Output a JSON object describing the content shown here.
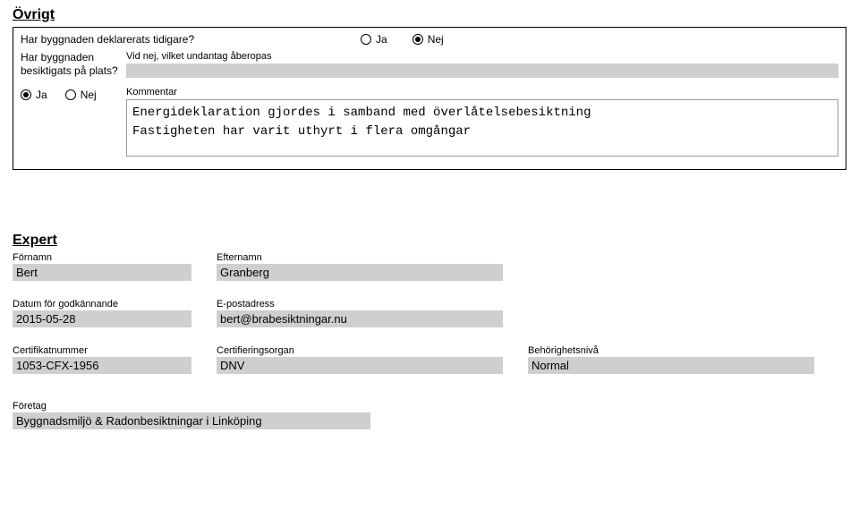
{
  "ovrigt": {
    "title": "Övrigt",
    "declared_question": "Har byggnaden deklarerats tidigare?",
    "inspected_question": "Har byggnaden besiktigats på plats?",
    "exemption_label": "Vid nej, vilket undantag åberopas",
    "exemption_value": "",
    "comment_label": "Kommentar",
    "comment_line1": "Energideklaration gjordes i samband med överlåtelsebesiktning",
    "comment_line2": "Fastigheten har varit uthyrt i flera omgångar",
    "ja": "Ja",
    "nej": "Nej"
  },
  "expert": {
    "title": "Expert",
    "fornamn_label": "Förnamn",
    "fornamn": "Bert",
    "efternamn_label": "Efternamn",
    "efternamn": "Granberg",
    "date_label": "Datum för godkännande",
    "date": "2015-05-28",
    "email_label": "E-postadress",
    "email": "bert@brabesiktningar.nu",
    "cert_label": "Certifikatnummer",
    "cert": "1053-CFX-1956",
    "org_label": "Certifieringsorgan",
    "org": "DNV",
    "level_label": "Behörighetsnivå",
    "level": "Normal",
    "company_label": "Företag",
    "company": "Byggnadsmiljö & Radonbesiktningar i Linköping"
  }
}
